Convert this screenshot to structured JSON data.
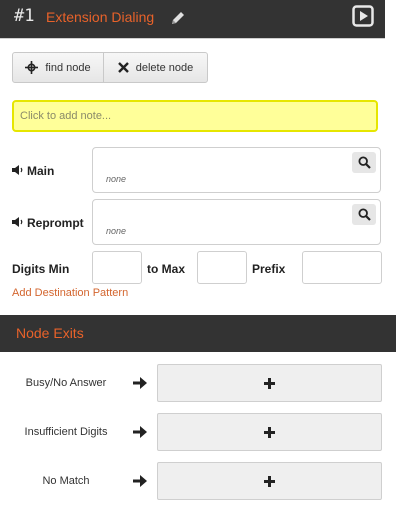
{
  "header": {
    "number": "#1",
    "title": "Extension Dialing",
    "accent": "#e8622a"
  },
  "toolbar": {
    "find_label": "find node",
    "delete_label": "delete node"
  },
  "note": {
    "placeholder": "Click to add note..."
  },
  "prompts": [
    {
      "label": "Main",
      "value": "none"
    },
    {
      "label": "Reprompt",
      "value": "none"
    }
  ],
  "digits": {
    "min_label": "Digits Min",
    "max_label": "to Max",
    "prefix_label": "Prefix",
    "min_value": "",
    "max_value": "",
    "prefix_value": ""
  },
  "add_pattern_label": "Add Destination Pattern",
  "exits": {
    "title": "Node Exits",
    "items": [
      {
        "label": "Busy/No Answer"
      },
      {
        "label": "Insufficient Digits"
      },
      {
        "label": "No Match"
      }
    ]
  }
}
